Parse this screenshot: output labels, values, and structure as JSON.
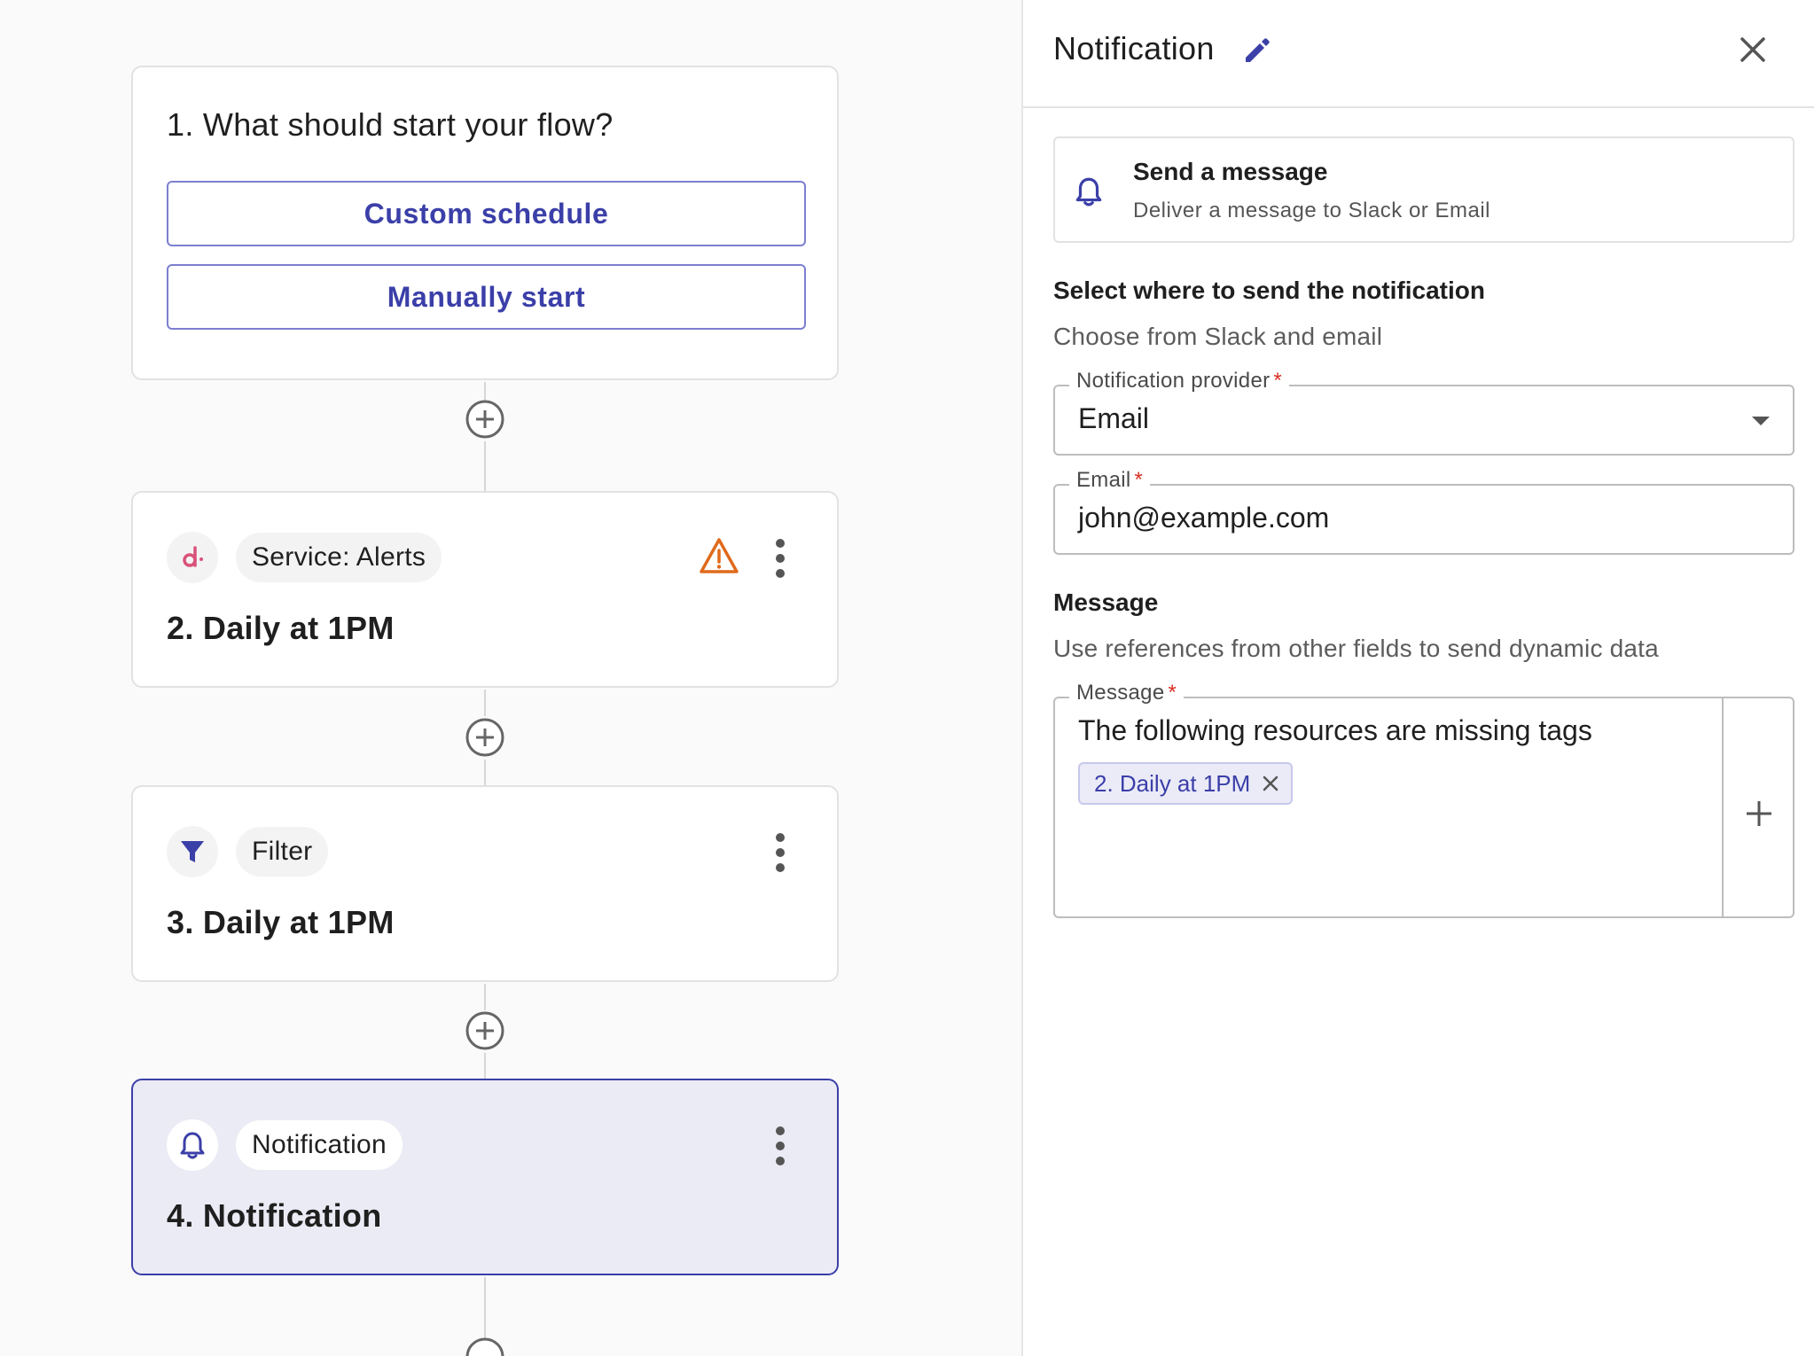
{
  "flow": {
    "start_card": {
      "title": "1. What should start your flow?",
      "custom_schedule_label": "Custom schedule",
      "manual_start_label": "Manually start"
    },
    "steps": [
      {
        "chip": "Service: Alerts",
        "title": "2. Daily at 1PM",
        "icon": "service-logo-icon",
        "has_warning": true
      },
      {
        "chip": "Filter",
        "title": "3. Daily at 1PM",
        "icon": "filter-icon",
        "has_warning": false
      },
      {
        "chip": "Notification",
        "title": "4. Notification",
        "icon": "bell-icon",
        "has_warning": false,
        "selected": true
      }
    ]
  },
  "panel": {
    "title": "Notification",
    "action": {
      "title": "Send a message",
      "subtitle": "Deliver a message to Slack or Email"
    },
    "destination": {
      "title": "Select where to send the notification",
      "subtitle": "Choose from Slack and email",
      "provider_label": "Notification provider",
      "provider_value": "Email",
      "email_label": "Email",
      "email_value": "john@example.com"
    },
    "message": {
      "title": "Message",
      "subtitle": "Use references from other fields to send dynamic data",
      "field_label": "Message",
      "text": "The following resources are missing tags",
      "reference_chip": "2. Daily at 1PM"
    },
    "required_marker": "*"
  },
  "colors": {
    "accent": "#3b3fa8",
    "warning": "#e06a1b",
    "required": "#d93025",
    "service_logo": "#d9527a"
  }
}
